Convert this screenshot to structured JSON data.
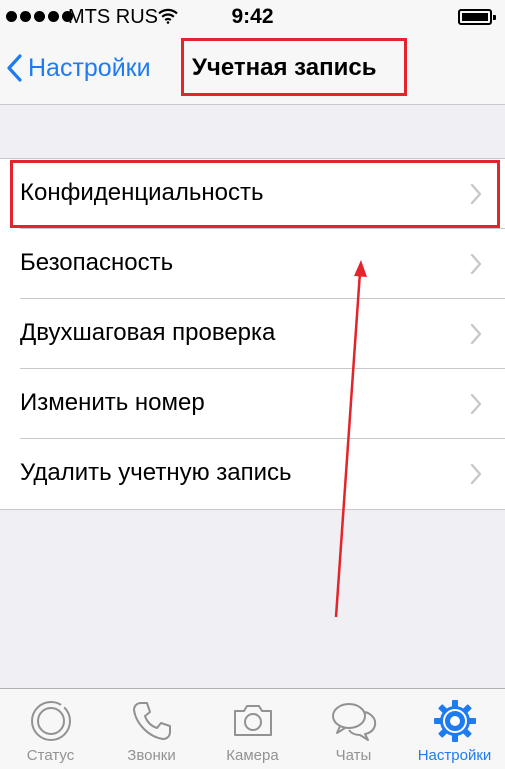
{
  "status_bar": {
    "carrier": "MTS RUS",
    "time": "9:42",
    "signal_icon": "signal-dots-icon",
    "wifi_icon": "wifi-icon",
    "battery_icon": "battery-icon"
  },
  "nav": {
    "back_label": "Настройки",
    "title": "Учетная запись"
  },
  "settings_items": [
    {
      "label": "Конфиденциальность",
      "icon": "chevron-right-icon"
    },
    {
      "label": "Безопасность",
      "icon": "chevron-right-icon"
    },
    {
      "label": "Двухшаговая проверка",
      "icon": "chevron-right-icon"
    },
    {
      "label": "Изменить номер",
      "icon": "chevron-right-icon"
    },
    {
      "label": "Удалить учетную запись",
      "icon": "chevron-right-icon"
    }
  ],
  "tab_bar": {
    "tabs": [
      {
        "label": "Статус",
        "icon": "status-icon"
      },
      {
        "label": "Звонки",
        "icon": "phone-icon"
      },
      {
        "label": "Камера",
        "icon": "camera-icon"
      },
      {
        "label": "Чаты",
        "icon": "chat-bubbles-icon"
      },
      {
        "label": "Настройки",
        "icon": "gear-icon"
      }
    ],
    "active_tab": "Настройки"
  },
  "colors": {
    "accent": "#1e7cf3",
    "annotation": "#e3242b",
    "background": "#efeff4",
    "bar": "#f7f7f7",
    "inactive": "#929292"
  }
}
